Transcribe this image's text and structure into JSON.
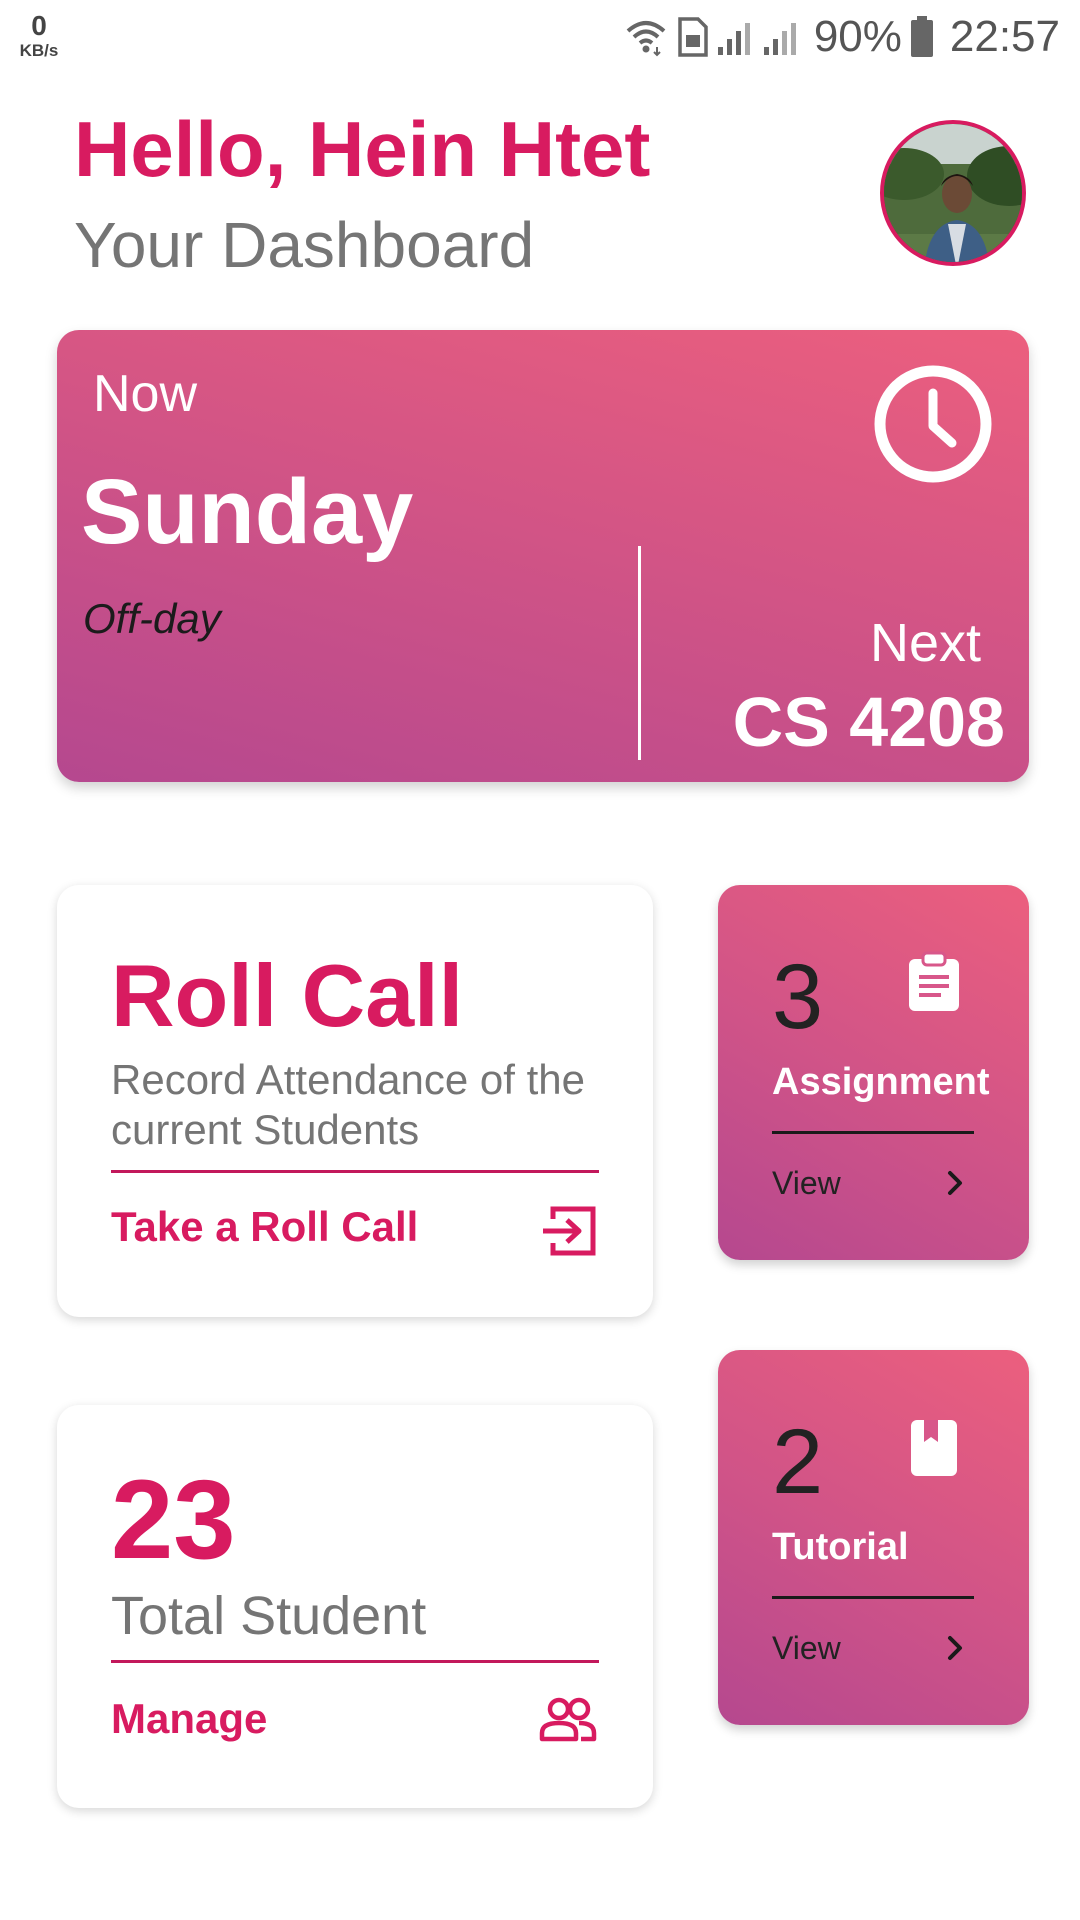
{
  "status_bar": {
    "net_speed_value": "0",
    "net_speed_unit": "KB/s",
    "battery_percent": "90%",
    "time": "22:57",
    "icons": [
      "wifi-icon",
      "sim-icon",
      "signal-icon",
      "signal-icon",
      "battery-icon"
    ]
  },
  "header": {
    "greeting": "Hello, Hein Htet",
    "subtitle": "Your Dashboard",
    "avatar_icon": "profile-photo"
  },
  "now_card": {
    "label": "Now",
    "day": "Sunday",
    "status": "Off-day",
    "next_label": "Next",
    "next_course": "CS 4208",
    "icon": "clock-icon"
  },
  "roll_call": {
    "title": "Roll Call",
    "description": "Record Attendance of the current Students",
    "action_label": "Take a Roll Call",
    "icon": "login-enter-icon"
  },
  "students": {
    "count": "23",
    "label": "Total Student",
    "action_label": "Manage",
    "icon": "people-icon"
  },
  "assignment": {
    "count": "3",
    "label": "Assignment",
    "view_label": "View",
    "icon": "clipboard-icon"
  },
  "tutorial": {
    "count": "2",
    "label": "Tutorial",
    "view_label": "View",
    "icon": "book-icon"
  },
  "colors": {
    "accent": "#d81b60",
    "gradient_start": "#b5488f",
    "gradient_end": "#ec5f7e",
    "muted_text": "#757575"
  }
}
